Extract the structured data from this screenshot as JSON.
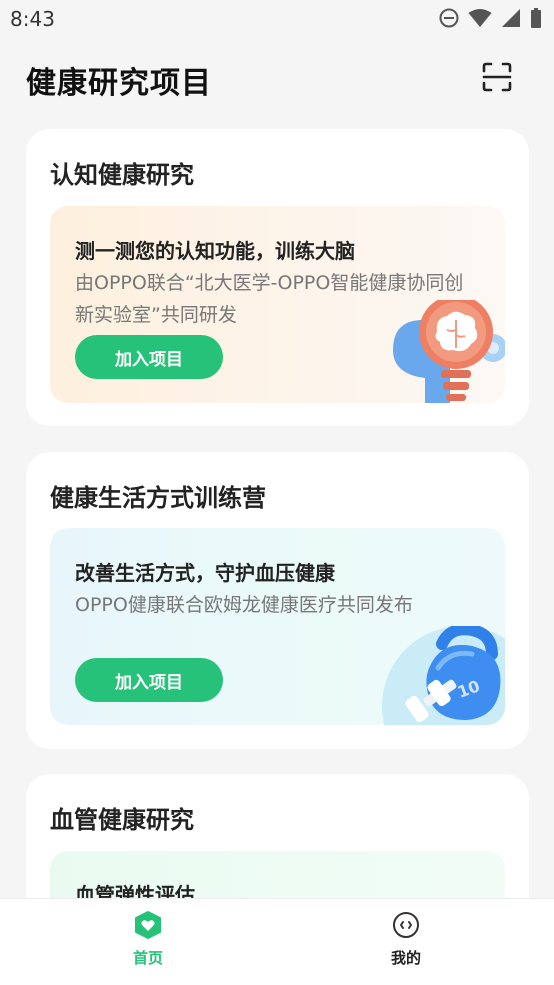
{
  "status": {
    "time": "8:43",
    "icons": [
      "do-not-disturb-icon",
      "wifi-icon",
      "signal-icon",
      "battery-icon"
    ]
  },
  "header": {
    "title": "健康研究项目",
    "scan_icon": "scan-icon"
  },
  "cards": [
    {
      "title": "认知健康研究",
      "headline": "测一测您的认知功能，训练大脑",
      "description": "由OPPO联合“北大医学-OPPO智能健康协同创新实验室”共同研发",
      "button": "加入项目",
      "illustration": "brain-icon"
    },
    {
      "title": "健康生活方式训练营",
      "headline": "改善生活方式，守护血压健康",
      "description": "OPPO健康联合欧姆龙健康医疗共同发布",
      "button": "加入项目",
      "illustration": "kettlebell-icon"
    },
    {
      "title": "血管健康研究",
      "headline": "血管弹性评估"
    }
  ],
  "bottom_nav": {
    "items": [
      {
        "label": "首页",
        "icon": "home-heart-icon",
        "active": true
      },
      {
        "label": "我的",
        "icon": "profile-face-icon",
        "active": false
      }
    ]
  },
  "colors": {
    "accent": "#27c27a",
    "background": "#f5f5f5",
    "card": "#ffffff"
  }
}
